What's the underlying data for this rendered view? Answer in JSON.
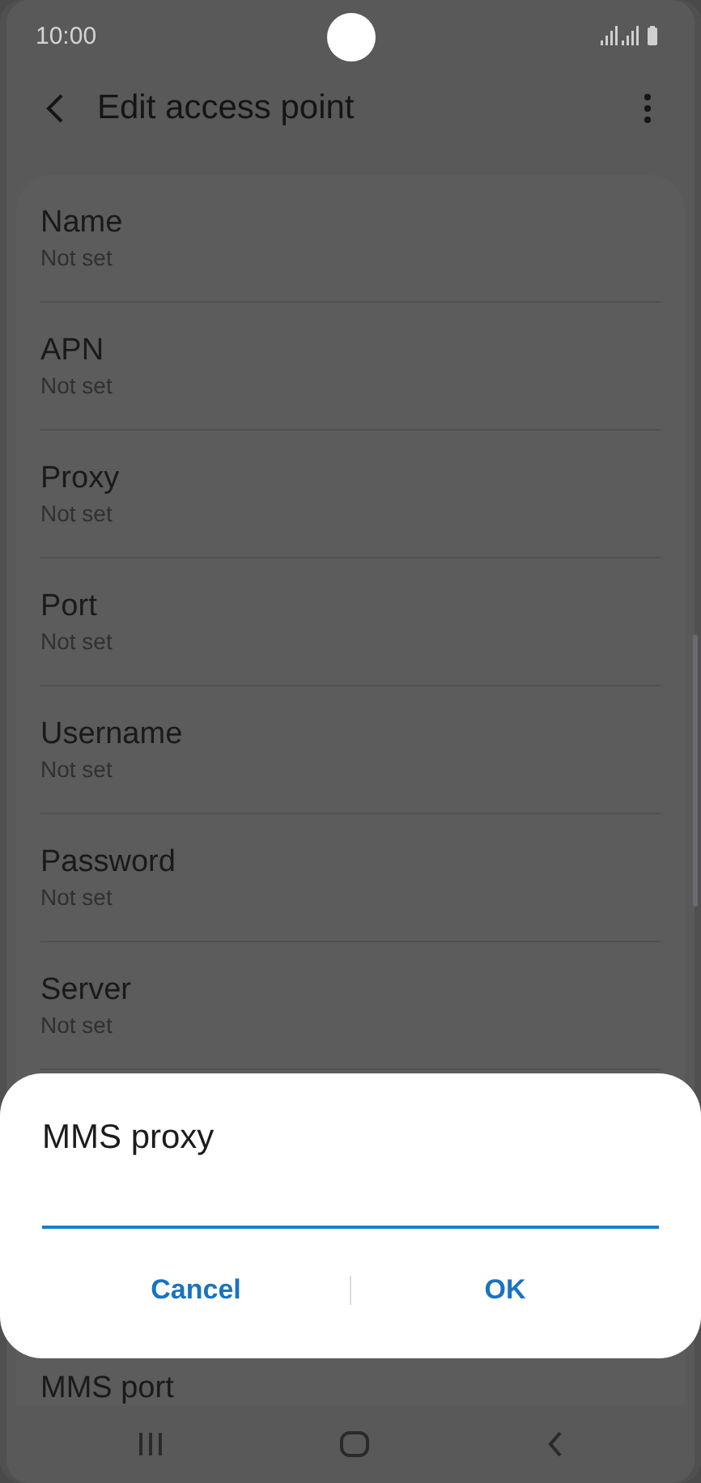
{
  "status_bar": {
    "time": "10:00"
  },
  "header": {
    "title": "Edit access point"
  },
  "settings": [
    {
      "label": "Name",
      "value": "Not set"
    },
    {
      "label": "APN",
      "value": "Not set"
    },
    {
      "label": "Proxy",
      "value": "Not set"
    },
    {
      "label": "Port",
      "value": "Not set"
    },
    {
      "label": "Username",
      "value": "Not set"
    },
    {
      "label": "Password",
      "value": "Not set"
    },
    {
      "label": "Server",
      "value": "Not set"
    }
  ],
  "partial_setting": {
    "label": "MMS port"
  },
  "dialog": {
    "title": "MMS proxy",
    "field": {
      "focused": true
    },
    "buttons": [
      "Cancel",
      "OK"
    ]
  }
}
